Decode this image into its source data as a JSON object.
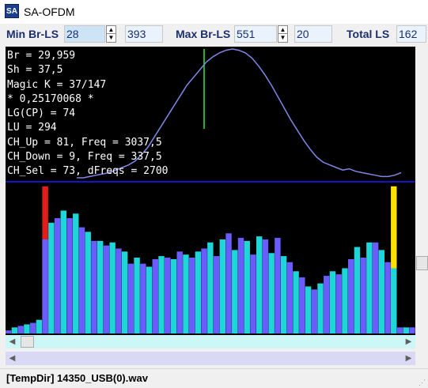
{
  "window": {
    "icon_text": "SA",
    "title": "SA-OFDM"
  },
  "toolbar": {
    "min_br_ls_label": "Min Br-LS",
    "min_br_ls_value": "28",
    "min_readout": "393",
    "max_br_ls_label": "Max Br-LS",
    "max_br_ls_value": "551",
    "max_readout": "20",
    "total_ls_label": "Total LS",
    "total_ls_value": "162"
  },
  "info_lines": [
    "Br = 29,959",
    "Sh = 37,5",
    "Magic K = 37/147",
    "* 0,25170068 *",
    "LG(CP) = 74",
    "LU = 294",
    "CH_Up = 81, Freq = 3037,5",
    "CH_Down = 9, Freq = 337,5",
    "CH_Sel = 73, dFreqs = 2700"
  ],
  "chart_data": {
    "type": "bar",
    "bars_total": 58,
    "values": [
      2,
      4,
      5,
      6,
      7,
      9,
      62,
      73,
      76,
      81,
      76,
      79,
      70,
      67,
      61,
      61,
      58,
      60,
      56,
      54,
      46,
      50,
      46,
      44,
      49,
      51,
      50,
      49,
      54,
      52,
      50,
      54,
      56,
      60,
      51,
      62,
      66,
      55,
      63,
      61,
      52,
      64,
      62,
      53,
      63,
      51,
      47,
      41,
      37,
      31,
      29,
      33,
      38,
      41,
      39,
      43,
      49,
      57,
      50,
      60,
      60,
      55,
      47,
      43,
      4,
      4,
      4
    ],
    "marker_red_index": 6,
    "marker_yellow_index": 63,
    "colors": {
      "bar_a": "#6a5cff",
      "bar_b": "#1ed6d8",
      "marker_red": "#e31c1c",
      "marker_yellow": "#ffe100",
      "curve": "#7f86e6",
      "baseline": "#1414c8",
      "vline": "#1fb51f",
      "background": "#000000"
    },
    "curve": [
      [
        0,
        100
      ],
      [
        2,
        100
      ],
      [
        4,
        99
      ],
      [
        6,
        98
      ],
      [
        8,
        97
      ],
      [
        10,
        96
      ],
      [
        12,
        94
      ],
      [
        14,
        92
      ],
      [
        16,
        90
      ],
      [
        18,
        87
      ],
      [
        20,
        82
      ],
      [
        22,
        76
      ],
      [
        24,
        68
      ],
      [
        26,
        60
      ],
      [
        28,
        52
      ],
      [
        30,
        44
      ],
      [
        32,
        36
      ],
      [
        34,
        28
      ],
      [
        36,
        22
      ],
      [
        38,
        16
      ],
      [
        40,
        10
      ],
      [
        42,
        6
      ],
      [
        44,
        3
      ],
      [
        46,
        1
      ],
      [
        48,
        0
      ],
      [
        50,
        1
      ],
      [
        52,
        3
      ],
      [
        54,
        7
      ],
      [
        56,
        13
      ],
      [
        58,
        20
      ],
      [
        60,
        28
      ],
      [
        62,
        37
      ],
      [
        64,
        46
      ],
      [
        66,
        55
      ],
      [
        68,
        63
      ],
      [
        70,
        71
      ],
      [
        72,
        78
      ],
      [
        74,
        84
      ],
      [
        76,
        88
      ],
      [
        78,
        90
      ],
      [
        80,
        92
      ],
      [
        82,
        94
      ],
      [
        84,
        93
      ],
      [
        86,
        95
      ],
      [
        88,
        96
      ],
      [
        90,
        97
      ],
      [
        92,
        98
      ],
      [
        94,
        99
      ],
      [
        96,
        99
      ],
      [
        98,
        98
      ],
      [
        100,
        96
      ]
    ]
  },
  "status": {
    "file": "[TempDir] 14350_USB(0).wav"
  }
}
